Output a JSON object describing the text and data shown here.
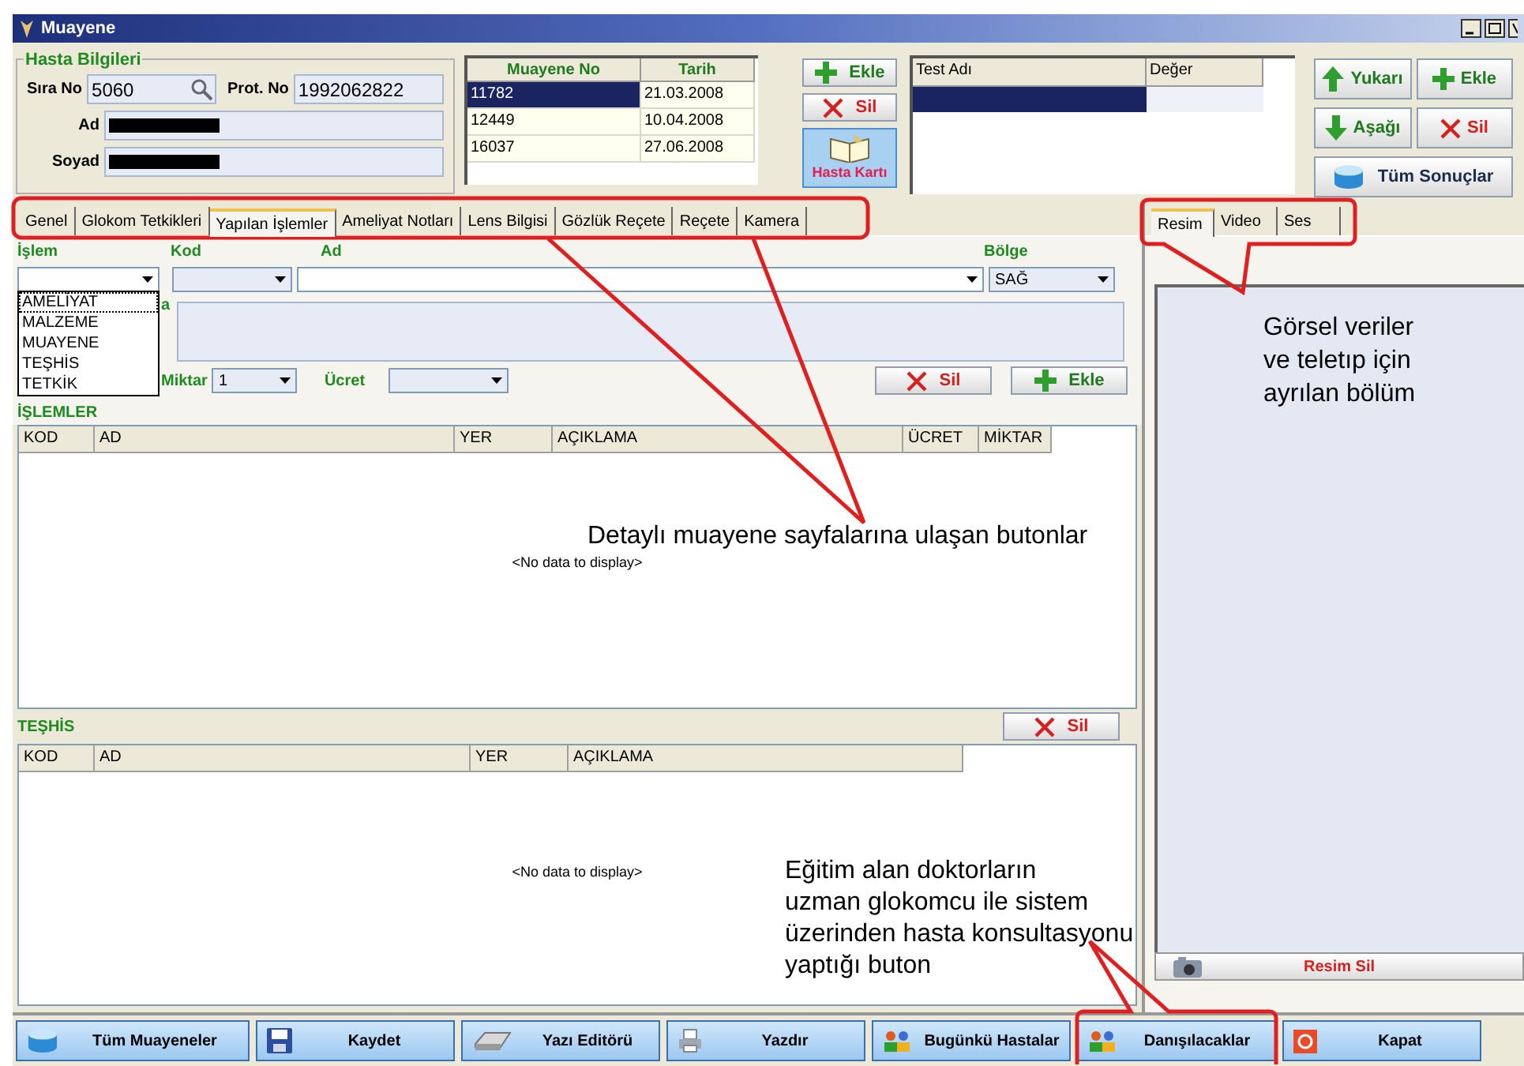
{
  "window": {
    "title": "Muayene"
  },
  "patient": {
    "legend": "Hasta Bilgileri",
    "fields": [
      {
        "label": "Sıra No",
        "value": "5060"
      },
      {
        "label": "Prot. No",
        "value": "1992062822"
      },
      {
        "label": "Ad",
        "redacted": true
      },
      {
        "label": "Soyad",
        "redacted": true
      }
    ]
  },
  "exams": {
    "columns": [
      "Muayene No",
      "Tarih"
    ],
    "rows": [
      {
        "cells": [
          "11782",
          "21.03.2008"
        ],
        "selected": true
      },
      {
        "cells": [
          "12449",
          "10.04.2008"
        ],
        "selected": false
      },
      {
        "cells": [
          "16037",
          "27.06.2008"
        ],
        "selected": false
      }
    ]
  },
  "exam_buttons": [
    {
      "kind": "add",
      "label": "Ekle"
    },
    {
      "kind": "delete",
      "label": "Sil"
    },
    {
      "kind": "card",
      "label": "Hasta Kartı"
    }
  ],
  "tests": {
    "columns": [
      "Test Adı",
      "Değer"
    ],
    "rows": [
      {
        "selected": true
      }
    ]
  },
  "test_buttons": [
    {
      "kind": "up",
      "label": "Yukarı"
    },
    {
      "kind": "add",
      "label": "Ekle"
    },
    {
      "kind": "down",
      "label": "Aşağı"
    },
    {
      "kind": "delete",
      "label": "Sil"
    },
    {
      "kind": "all",
      "label": "Tüm Sonuçlar"
    }
  ],
  "tabs": [
    {
      "label": "Genel",
      "selected": false
    },
    {
      "label": "Glokom Tetkikleri",
      "selected": false
    },
    {
      "label": "Yapılan İşlemler",
      "selected": true
    },
    {
      "label": "Ameliyat Notları",
      "selected": false
    },
    {
      "label": "Lens Bilgisi",
      "selected": false
    },
    {
      "label": "Gözlük Reçete",
      "selected": false
    },
    {
      "label": "Reçete",
      "selected": false
    },
    {
      "label": "Kamera",
      "selected": false
    }
  ],
  "form": {
    "islem_label": "İşlem",
    "kod_label": "Kod",
    "ad_label": "Ad",
    "bolge_label": "Bölge",
    "bolge_value": "SAĞ",
    "hidden_label_tail": "a",
    "islem_options": [
      {
        "label": "AMELİYAT",
        "selected": true
      },
      {
        "label": "MALZEME",
        "selected": false
      },
      {
        "label": "MUAYENE",
        "selected": false
      },
      {
        "label": "TEŞHİS",
        "selected": false
      },
      {
        "label": "TETKİK",
        "selected": false
      }
    ],
    "miktar_label": "Miktar",
    "miktar_value": "1",
    "ucret_label": "Ücret",
    "buttons": [
      {
        "kind": "delete",
        "label": "Sil"
      },
      {
        "kind": "add",
        "label": "Ekle"
      }
    ]
  },
  "islemler": {
    "title": "İŞLEMLER",
    "columns": [
      "KOD",
      "AD",
      "YER",
      "AÇIKLAMA",
      "ÜCRET",
      "MİKTAR"
    ],
    "empty": "<No data to display>"
  },
  "teshis": {
    "title": "TEŞHİS",
    "button": {
      "kind": "delete",
      "label": "Sil"
    },
    "columns": [
      "KOD",
      "AD",
      "YER",
      "AÇIKLAMA"
    ],
    "empty": "<No data to display>"
  },
  "media_tabs": [
    {
      "label": "Resim",
      "selected": true
    },
    {
      "label": "Video",
      "selected": false
    },
    {
      "label": "Ses",
      "selected": false
    }
  ],
  "media_button": "Resim Sil",
  "toolbar": [
    "Tüm Muayeneler",
    "Kaydet",
    "Yazı Editörü",
    "Yazdır",
    "Bugünkü Hastalar",
    "Danışılacaklar",
    "Kapat"
  ],
  "annotations": [
    {
      "kind": "tabs",
      "text": "Detaylı muayene sayfalarına ulaşan butonlar"
    },
    {
      "kind": "media",
      "lines": [
        "Görsel veriler",
        "ve teletıp için",
        "ayrılan bölüm"
      ]
    },
    {
      "kind": "consult",
      "lines": [
        "Eğitim alan doktorların",
        "uzman glokomcu ile sistem",
        "üzerinden hasta konsultasyonu",
        "yaptığı buton"
      ]
    }
  ]
}
